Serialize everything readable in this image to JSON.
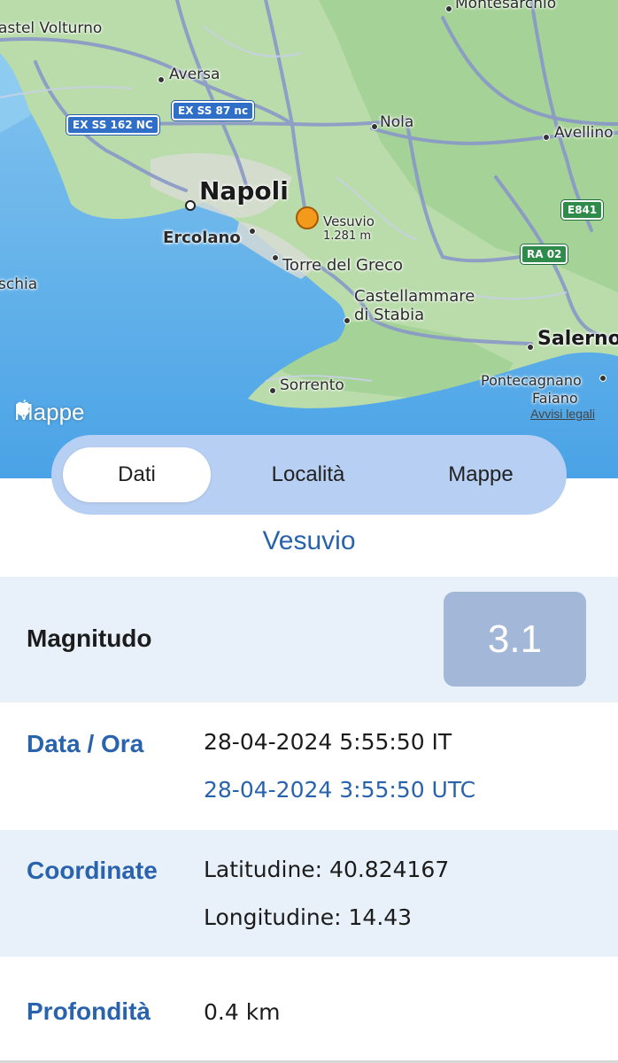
{
  "map": {
    "attribution": "Mappe",
    "legal_link": "Avvisi legali",
    "places": {
      "castel_volturno": "astel Volturno",
      "montesarchio": "Montesarchio",
      "aversa": "Aversa",
      "nola": "Nola",
      "avellino": "Avellino",
      "napoli": "Napoli",
      "vesuvio": "Vesuvio",
      "vesuvio_alt": "1.281 m",
      "ercolano": "Ercolano",
      "torre_del_greco": "Torre del Greco",
      "ischia": "schia",
      "castellammare_1": "Castellammare",
      "castellammare_2": "di Stabia",
      "salerno": "Salerno",
      "sorrento": "Sorrento",
      "pontecagnano_1": "Pontecagnano",
      "pontecagnano_2": "Faiano"
    },
    "roads": {
      "ex_ss_162": "EX SS 162 NC",
      "ex_ss_87": "EX SS 87 nc",
      "e841": "E841",
      "ra02": "RA 02"
    },
    "colors": {
      "sea": "#6fb7ea",
      "land": "#b9dcaa",
      "marker": "#f39a1d"
    }
  },
  "tabs": [
    "Dati",
    "Località",
    "Mappe"
  ],
  "active_tab": "Dati",
  "detail": {
    "title": "Vesuvio",
    "magnitude_label": "Magnitudo",
    "magnitude_value": "3.1",
    "datetime_label": "Data / Ora",
    "datetime_local": "28-04-2024 5:55:50 IT",
    "datetime_utc": "28-04-2024 3:55:50 UTC",
    "coordinates_label": "Coordinate",
    "latitude": "Latitudine: 40.824167",
    "longitude": "Longitudine: 14.43",
    "depth_label": "Profondità",
    "depth_value": "0.4 km"
  },
  "colors": {
    "accent": "#2a63ad",
    "segment_bg": "#b7cff2",
    "row_shade": "#e8f0fa",
    "magnitude_box": "#a3b8d9"
  }
}
